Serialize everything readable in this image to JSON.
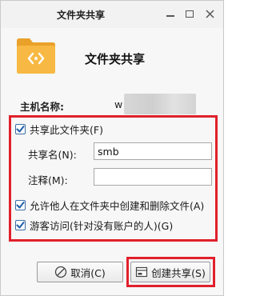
{
  "window": {
    "title": "文件夹共享"
  },
  "header": {
    "heading": "文件夹共享"
  },
  "host": {
    "label": "主机名称:",
    "value": "w"
  },
  "share": {
    "enable_label": "共享此文件夹(F)",
    "enable_checked": true,
    "name_label": "共享名(N):",
    "name_value": "smb",
    "comment_label": "注释(M):",
    "comment_value": "",
    "allow_others_label": "允许他人在文件夹中创建和删除文件(A)",
    "allow_others_checked": true,
    "guest_label": "游客访问(针对没有账户的人)(G)",
    "guest_checked": true
  },
  "buttons": {
    "cancel": "取消(C)",
    "create": "创建共享(S)"
  },
  "colors": {
    "highlight": "#e0202a",
    "folder": "#f5b13a",
    "checkbox_border": "#3b6ea5"
  }
}
